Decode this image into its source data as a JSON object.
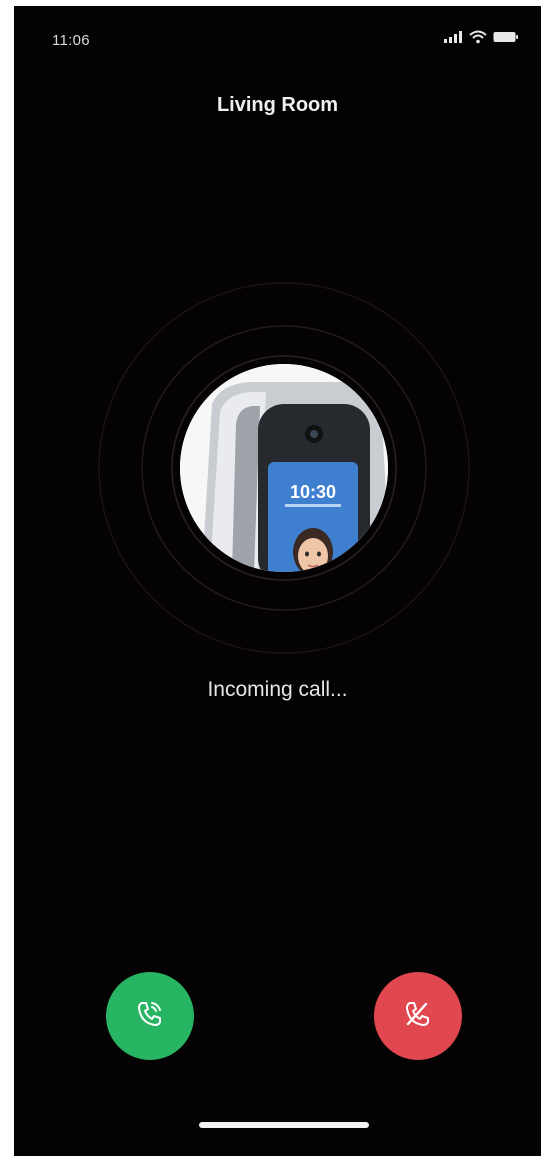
{
  "status_bar": {
    "time": "11:06",
    "icons": [
      "signal-icon",
      "wifi-icon",
      "battery-icon"
    ]
  },
  "header": {
    "title": "Living Room"
  },
  "caller": {
    "avatar": "door-lock-device-image",
    "device_screen_time": "10:30",
    "status_text": "Incoming call..."
  },
  "actions": {
    "accept_icon": "phone-accept-icon",
    "decline_icon": "phone-decline-icon"
  },
  "colors": {
    "background": "#050203",
    "accept": "#27b564",
    "decline": "#e0474e",
    "text": "#f0f0f0"
  }
}
